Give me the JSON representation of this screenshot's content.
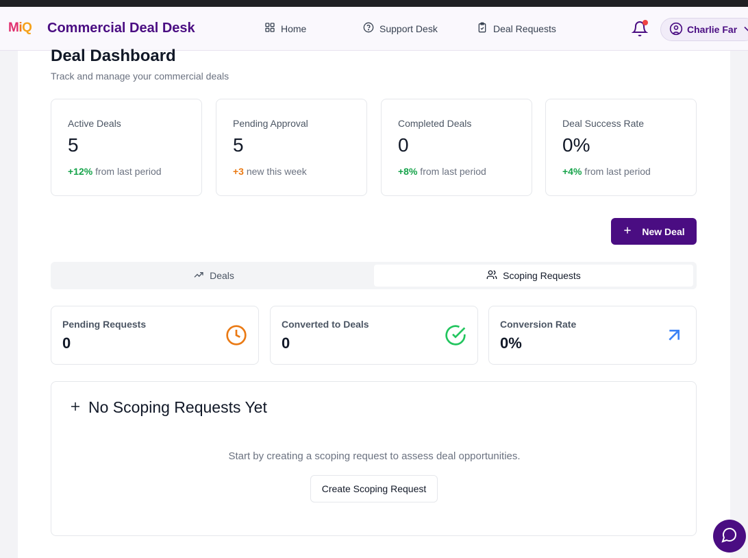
{
  "header": {
    "logo": {
      "m": "M",
      "i": "i",
      "q": "Q"
    },
    "app_title": "Commercial Deal Desk",
    "nav": [
      {
        "label": "Home",
        "icon": "grid-icon"
      },
      {
        "label": "Support Desk",
        "icon": "help-circle-icon"
      },
      {
        "label": "Deal Requests",
        "icon": "clipboard-icon"
      }
    ],
    "user_name": "Charlie Far",
    "notifications_has_unread": true
  },
  "dashboard": {
    "title": "Deal Dashboard",
    "subtitle": "Track and manage your commercial deals"
  },
  "stats": [
    {
      "label": "Active Deals",
      "value": "5",
      "change": "+12%",
      "change_text": " from last period",
      "tone": "up"
    },
    {
      "label": "Pending Approval",
      "value": "5",
      "change": "+3",
      "change_text": " new this week",
      "tone": "warn"
    },
    {
      "label": "Completed Deals",
      "value": "0",
      "change": "+8%",
      "change_text": " from last period",
      "tone": "up"
    },
    {
      "label": "Deal Success Rate",
      "value": "0%",
      "change": "+4%",
      "change_text": " from last period",
      "tone": "up"
    }
  ],
  "actions": {
    "new_deal": "New Deal"
  },
  "tabs": [
    {
      "label": "Deals",
      "icon": "trending-up-icon",
      "active": false
    },
    {
      "label": "Scoping Requests",
      "icon": "users-icon",
      "active": true
    }
  ],
  "scoping_metrics": [
    {
      "label": "Pending Requests",
      "value": "0",
      "icon": "clock-icon",
      "color": "#ea7a14"
    },
    {
      "label": "Converted to Deals",
      "value": "0",
      "icon": "check-circle-icon",
      "color": "#22c55e"
    },
    {
      "label": "Conversion Rate",
      "value": "0%",
      "icon": "arrow-up-right-icon",
      "color": "#3b82f6"
    }
  ],
  "empty_state": {
    "title": "No Scoping Requests Yet",
    "text": "Start by creating a scoping request to assess deal opportunities.",
    "button": "Create Scoping Request"
  },
  "colors": {
    "brand": "#4a0d82",
    "positive": "#16a34a",
    "warning": "#ea7a14"
  }
}
